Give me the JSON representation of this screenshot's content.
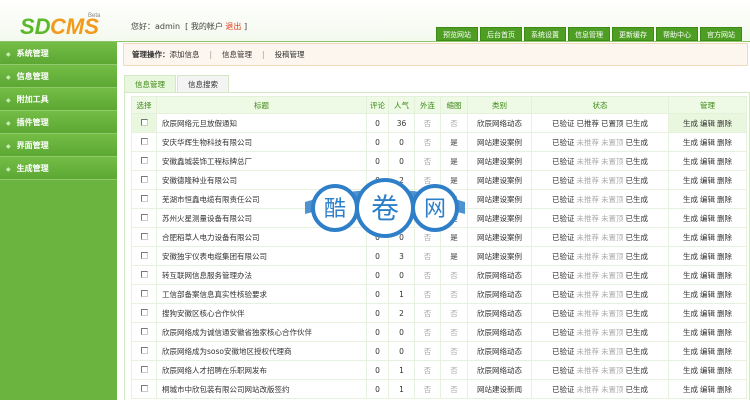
{
  "logo": {
    "text": "SDCMS",
    "badge": "Beta"
  },
  "welcome": {
    "greeting": "您好：admin",
    "bracket_open": "[",
    "account": "我的帐户",
    "logout": "退出",
    "bracket_close": "]"
  },
  "topnav": [
    "预览网站",
    "后台首页",
    "系统设置",
    "信息管理",
    "更新缓存",
    "帮助中心",
    "官方网站"
  ],
  "sidebar": [
    "系统管理",
    "信息管理",
    "附加工具",
    "插件管理",
    "界面管理",
    "生成管理"
  ],
  "crumb": {
    "label": "管理操作：",
    "links": [
      "添加信息",
      "信息管理",
      "投稿管理"
    ],
    "sep": "|"
  },
  "tabs": [
    "信息管理",
    "信息搜索"
  ],
  "columns": [
    "选择",
    "标题",
    "评论",
    "人气",
    "外连",
    "缩图",
    "类别",
    "状态",
    "管理"
  ],
  "rows": [
    {
      "title": "欣辰网络元旦放假通知",
      "comments": "0",
      "views": "36",
      "ext": "否",
      "thumb": "否",
      "cat": "欣辰网络动态",
      "rec": "已推荐",
      "top": "已置顶"
    },
    {
      "title": "安庆华辉生物科技有限公司",
      "comments": "0",
      "views": "0",
      "ext": "否",
      "thumb": "是",
      "cat": "网站建设案例",
      "rec": "未推荐",
      "top": "未置顶"
    },
    {
      "title": "安徽鑫城装饰工程标牌总厂",
      "comments": "0",
      "views": "0",
      "ext": "否",
      "thumb": "是",
      "cat": "网站建设案例",
      "rec": "未推荐",
      "top": "未置顶"
    },
    {
      "title": "安徽德隆种业有限公司",
      "comments": "0",
      "views": "2",
      "ext": "否",
      "thumb": "是",
      "cat": "网站建设案例",
      "rec": "未推荐",
      "top": "未置顶"
    },
    {
      "title": "芜湖市恒鑫电缆有限责任公司",
      "comments": "0",
      "views": "0",
      "ext": "否",
      "thumb": "是",
      "cat": "网站建设案例",
      "rec": "未推荐",
      "top": "未置顶"
    },
    {
      "title": "苏州火星测量设备有限公司",
      "comments": "0",
      "views": "0",
      "ext": "否",
      "thumb": "是",
      "cat": "网站建设案例",
      "rec": "未推荐",
      "top": "未置顶"
    },
    {
      "title": "合肥稻草人电力设备有限公司",
      "comments": "0",
      "views": "0",
      "ext": "否",
      "thumb": "是",
      "cat": "网站建设案例",
      "rec": "未推荐",
      "top": "未置顶"
    },
    {
      "title": "安徽独宇仪表电缆集团有限公司",
      "comments": "0",
      "views": "3",
      "ext": "否",
      "thumb": "是",
      "cat": "网站建设案例",
      "rec": "未推荐",
      "top": "未置顶"
    },
    {
      "title": "转互联网信息服务管理办法",
      "comments": "0",
      "views": "0",
      "ext": "否",
      "thumb": "否",
      "cat": "欣辰网络动态",
      "rec": "未推荐",
      "top": "未置顶"
    },
    {
      "title": "工信部备案信息真实性核验要求",
      "comments": "0",
      "views": "1",
      "ext": "否",
      "thumb": "否",
      "cat": "欣辰网络动态",
      "rec": "未推荐",
      "top": "未置顶"
    },
    {
      "title": "搜狗安徽区核心合作伙伴",
      "comments": "0",
      "views": "2",
      "ext": "否",
      "thumb": "否",
      "cat": "欣辰网络动态",
      "rec": "未推荐",
      "top": "未置顶"
    },
    {
      "title": "欣辰网络成为诚信通安徽省独家核心合作伙伴",
      "comments": "0",
      "views": "0",
      "ext": "否",
      "thumb": "否",
      "cat": "欣辰网络动态",
      "rec": "未推荐",
      "top": "未置顶"
    },
    {
      "title": "欣辰网络成为soso安徽地区授权代理商",
      "comments": "0",
      "views": "0",
      "ext": "否",
      "thumb": "否",
      "cat": "欣辰网络动态",
      "rec": "未推荐",
      "top": "未置顶"
    },
    {
      "title": "欣辰网络人才招聘在乐职网发布",
      "comments": "0",
      "views": "1",
      "ext": "否",
      "thumb": "否",
      "cat": "欣辰网络动态",
      "rec": "未推荐",
      "top": "未置顶"
    },
    {
      "title": "桐城市中欣包装有限公司网站改版签约",
      "comments": "0",
      "views": "1",
      "ext": "否",
      "thumb": "否",
      "cat": "网站建设新闻",
      "rec": "未推荐",
      "top": "未置顶"
    }
  ],
  "status_fixed": {
    "verified": "已验证",
    "generated": "已生成"
  },
  "actions": [
    "生成",
    "编辑",
    "删除"
  ],
  "watermark": "酷卷网"
}
